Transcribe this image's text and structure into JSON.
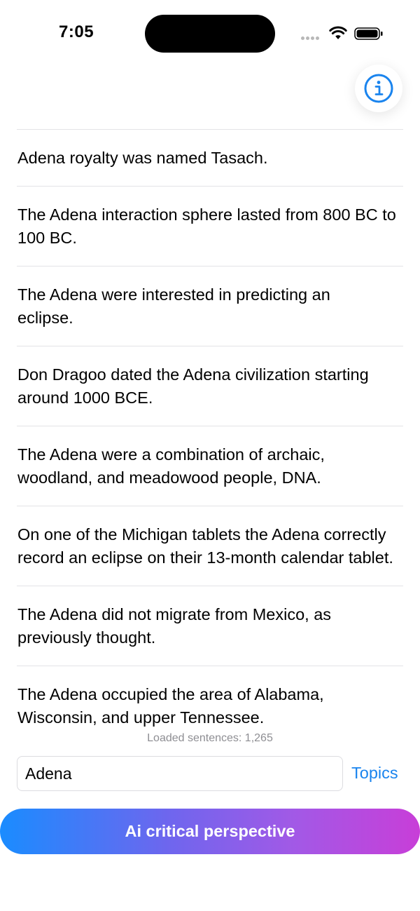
{
  "status_bar": {
    "time": "7:05"
  },
  "info_button": {
    "icon": "info-icon",
    "color": "#1a84ee"
  },
  "sentences": [
    "Adena royalty was named Tasach.",
    "The Adena interaction sphere lasted from 800 BC to 100 BC.",
    "The Adena were interested in predicting an eclipse.",
    "Don Dragoo dated the Adena civilization starting around 1000 BCE.",
    "The Adena were a combination of archaic, woodland, and meadowood people, DNA.",
    "On one of the Michigan tablets the Adena correctly record an eclipse on their 13-month calendar tablet.",
    "The Adena did not migrate from Mexico, as previously thought.",
    "The Adena occupied the area of Alabama, Wisconsin, and upper Tennessee."
  ],
  "footer": {
    "loaded_label": "Loaded sentences: 1,265",
    "search_value": "Adena",
    "topics_label": "Topics",
    "ai_button_label": "Ai critical perspective"
  },
  "colors": {
    "accent": "#1a84ee",
    "gradient_start": "#1a8cff",
    "gradient_end": "#c83ed8"
  }
}
